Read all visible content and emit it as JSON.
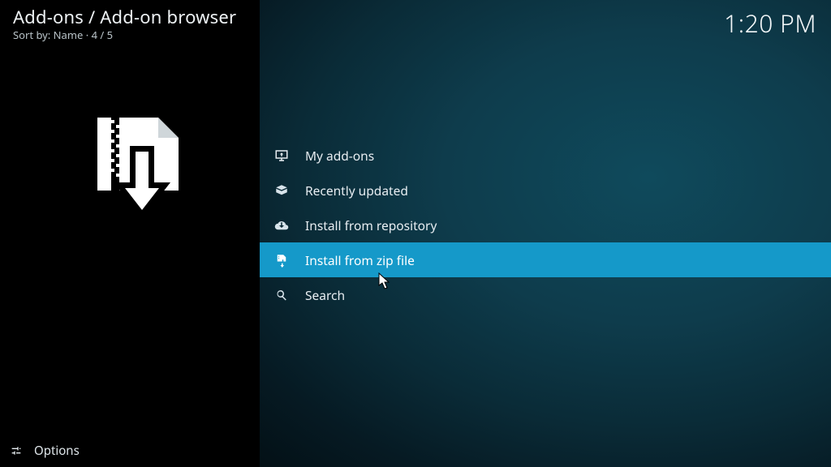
{
  "header": {
    "breadcrumb": "Add-ons / Add-on browser",
    "sort_prefix": "Sort by: ",
    "sort_field": "Name",
    "position": "4 / 5",
    "sortline_full": "Sort by: Name  ·  4 / 5"
  },
  "clock": "1:20 PM",
  "menu": {
    "items": [
      {
        "icon": "monitor-icon",
        "label": "My add-ons"
      },
      {
        "icon": "open-box-icon",
        "label": "Recently updated"
      },
      {
        "icon": "cloud-download-icon",
        "label": "Install from repository"
      },
      {
        "icon": "zip-download-icon",
        "label": "Install from zip file"
      },
      {
        "icon": "search-icon",
        "label": "Search"
      }
    ],
    "selected_index": 3
  },
  "footer": {
    "options_label": "Options"
  },
  "colors": {
    "accent": "#1599c9",
    "sidebar_bg": "#000000"
  }
}
